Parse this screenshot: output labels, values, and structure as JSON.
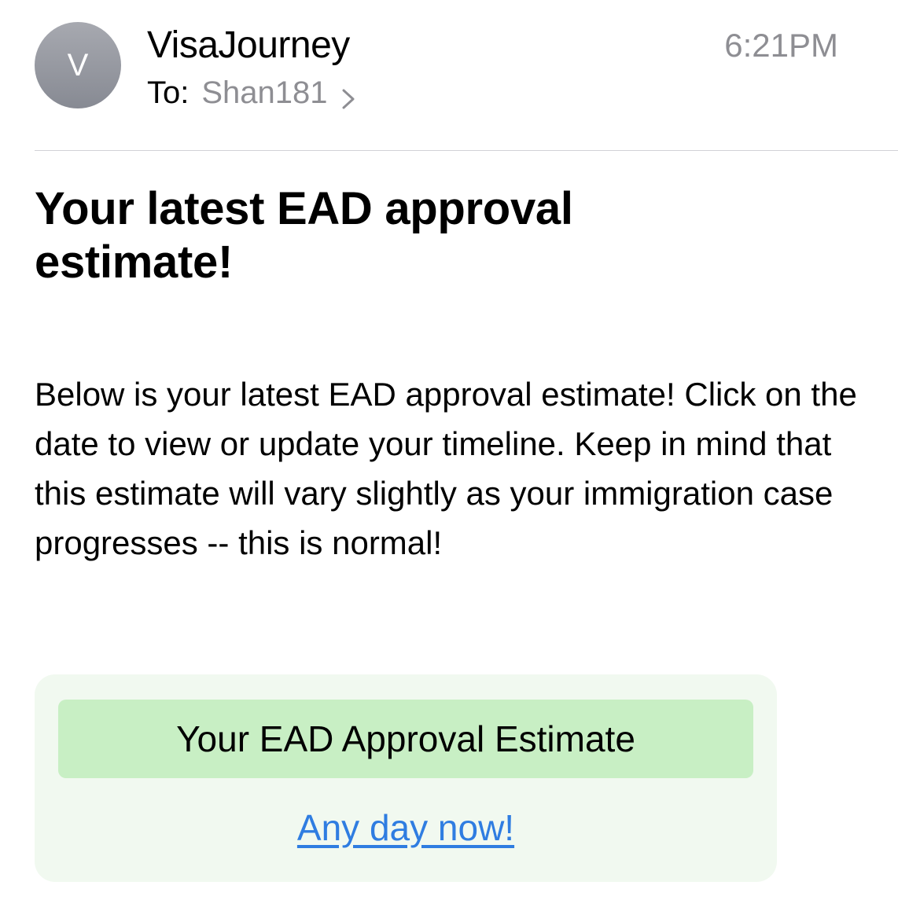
{
  "header": {
    "avatar_letter": "V",
    "sender": "VisaJourney",
    "to_label": "To:",
    "recipient": "Shan181",
    "time": "6:21PM"
  },
  "email": {
    "subject": "Your latest EAD approval estimate!",
    "body": "Below is your latest EAD approval estimate! Click on the date to view or update your timeline. Keep in mind that this estimate will vary slightly as your immigration case progresses -- this is normal!"
  },
  "estimate_card": {
    "heading": "Your EAD Approval Estimate",
    "link_text": "Any day now!"
  },
  "colors": {
    "link": "#2f7de1",
    "card_background": "#f1f9f0",
    "heading_background": "#c8efc4",
    "secondary_text": "#8e8e93"
  },
  "icons": {
    "recipient_disclosure": "chevron-right-icon"
  }
}
